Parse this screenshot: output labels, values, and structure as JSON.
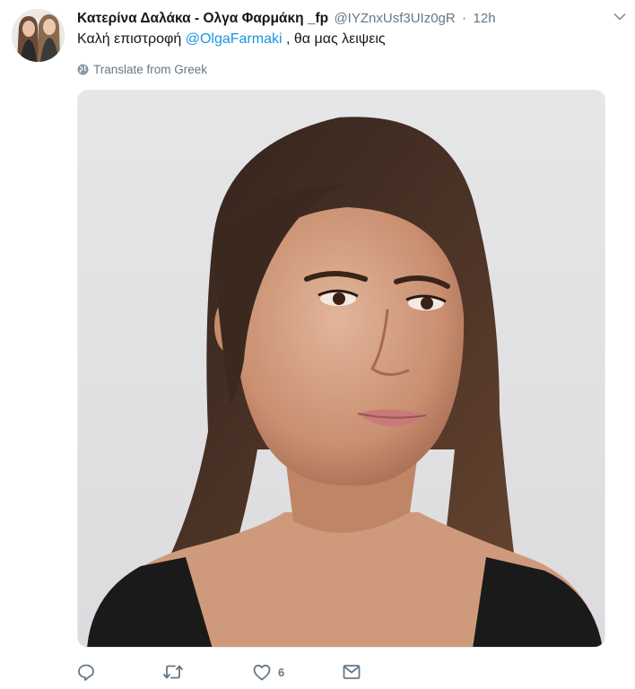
{
  "tweet": {
    "display_name": "Κατερίνα Δαλάκα - Ολγα Φαρμάκη _fp",
    "handle": "@IYZnxUsf3UIz0gR",
    "separator": "·",
    "time": "12h",
    "text_before": "Καλή επιστροφή ",
    "mention": "@OlgaFarmaki",
    "text_after": " , θα μας λειψεις",
    "translate_label": "Translate from Greek",
    "like_count": "6"
  },
  "icons": {
    "menu": "chevron-down-icon",
    "translate": "globe-icon",
    "reply": "reply-icon",
    "retweet": "retweet-icon",
    "like": "heart-icon",
    "dm": "envelope-icon"
  },
  "colors": {
    "text": "#14171a",
    "secondary": "#657786",
    "link": "#1b95e0"
  }
}
